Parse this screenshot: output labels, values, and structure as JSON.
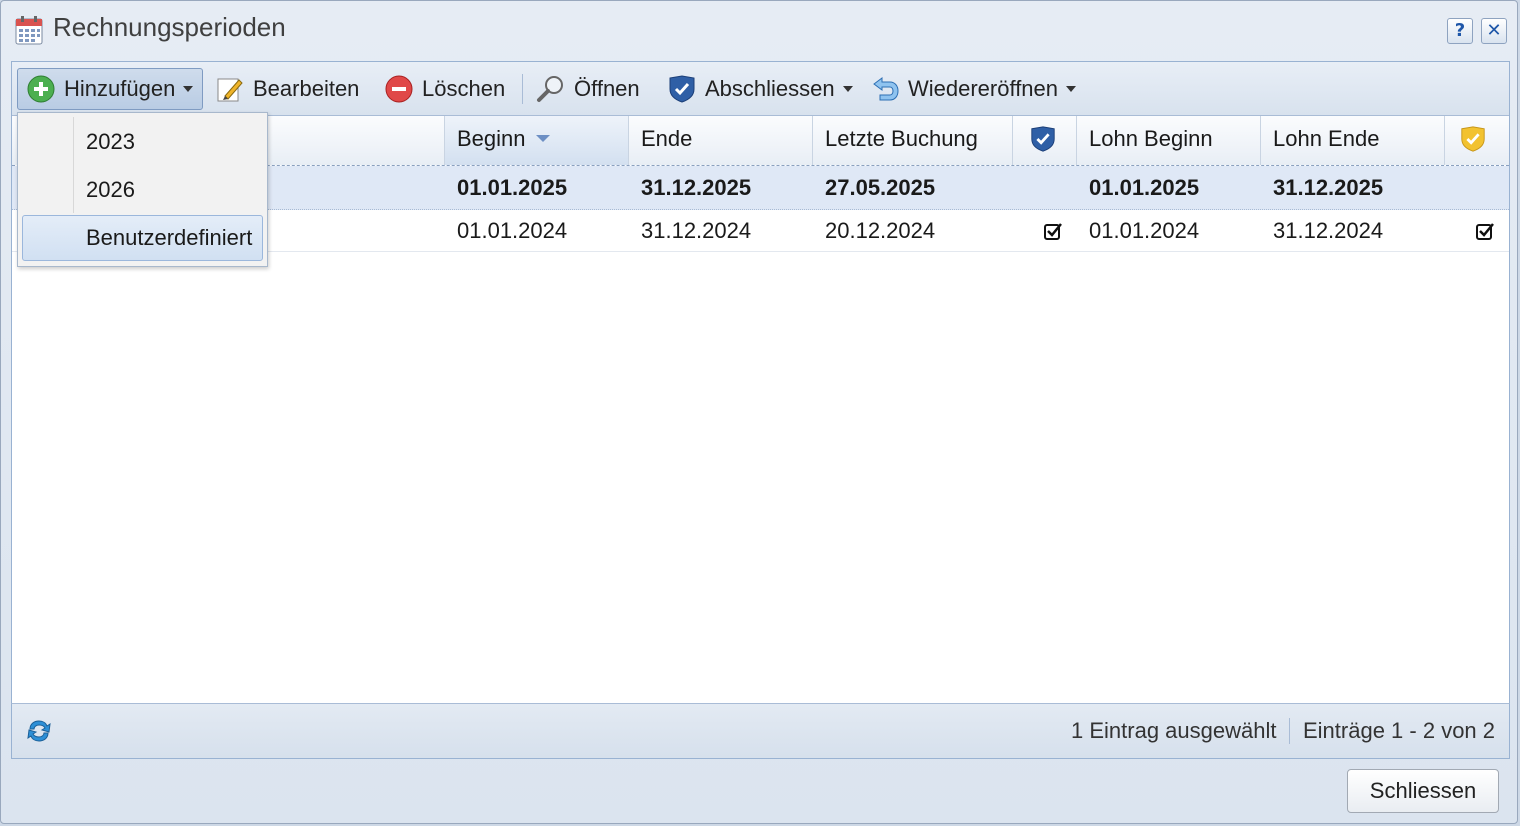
{
  "window": {
    "title": "Rechnungsperioden",
    "help_label": "?",
    "close_label": "✕"
  },
  "toolbar": {
    "add": "Hinzufügen",
    "edit": "Bearbeiten",
    "delete": "Löschen",
    "open": "Öffnen",
    "close_period": "Abschliessen",
    "reopen": "Wiedereröffnen"
  },
  "dropdown": {
    "items": [
      "2023",
      "2026",
      "Benutzerdefiniert"
    ]
  },
  "grid": {
    "columns": [
      "Beginn",
      "Ende",
      "Letzte Buchung",
      "Lohn Beginn",
      "Lohn Ende"
    ],
    "rows": [
      {
        "beginn": "01.01.2025",
        "ende": "31.12.2025",
        "letzte_buchung": "27.05.2025",
        "closed": false,
        "lohn_beginn": "01.01.2025",
        "lohn_ende": "31.12.2025",
        "lohn_closed": false,
        "selected": true
      },
      {
        "beginn": "01.01.2024",
        "ende": "31.12.2024",
        "letzte_buchung": "20.12.2024",
        "closed": true,
        "lohn_beginn": "01.01.2024",
        "lohn_ende": "31.12.2024",
        "lohn_closed": true,
        "selected": false
      }
    ]
  },
  "status": {
    "selection": "1 Eintrag ausgewählt",
    "range": "Einträge 1 - 2 von 2"
  },
  "footer": {
    "close_button": "Schliessen"
  },
  "colors": {
    "accent": "#2f5fa6",
    "selected_row": "#dfe8f6",
    "gold_shield": "#f2c230"
  }
}
